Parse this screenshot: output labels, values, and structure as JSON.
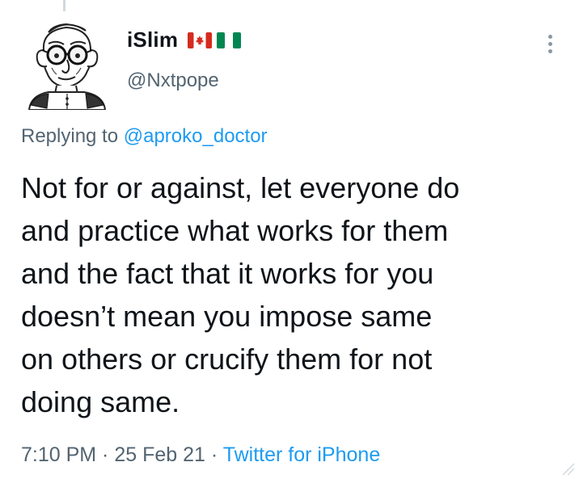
{
  "user": {
    "display_name": "iSlim",
    "handle": "@Nxtpope",
    "flags": [
      "canada-flag",
      "nigeria-flag"
    ],
    "avatar_icon": "pope-sketch-avatar"
  },
  "reply_context": {
    "prefix": "Replying to",
    "mention": "@aproko_doctor"
  },
  "tweet": {
    "lines": [
      "Not for or against, let everyone do",
      "and practice what works for them",
      "and the fact that it works for you",
      "doesn’t mean you impose same",
      "on others or crucify them for not",
      "doing same."
    ]
  },
  "meta": {
    "time": "7:10 PM",
    "separator": " · ",
    "date": "25 Feb 21",
    "source": "Twitter for iPhone"
  },
  "colors": {
    "link": "#1d9bf0",
    "secondary_text": "#536471",
    "primary_text": "#0f1419",
    "canada_red": "#d52b1e",
    "nigeria_green": "#008751"
  },
  "icons": {
    "more": "more-vertical-icon"
  }
}
